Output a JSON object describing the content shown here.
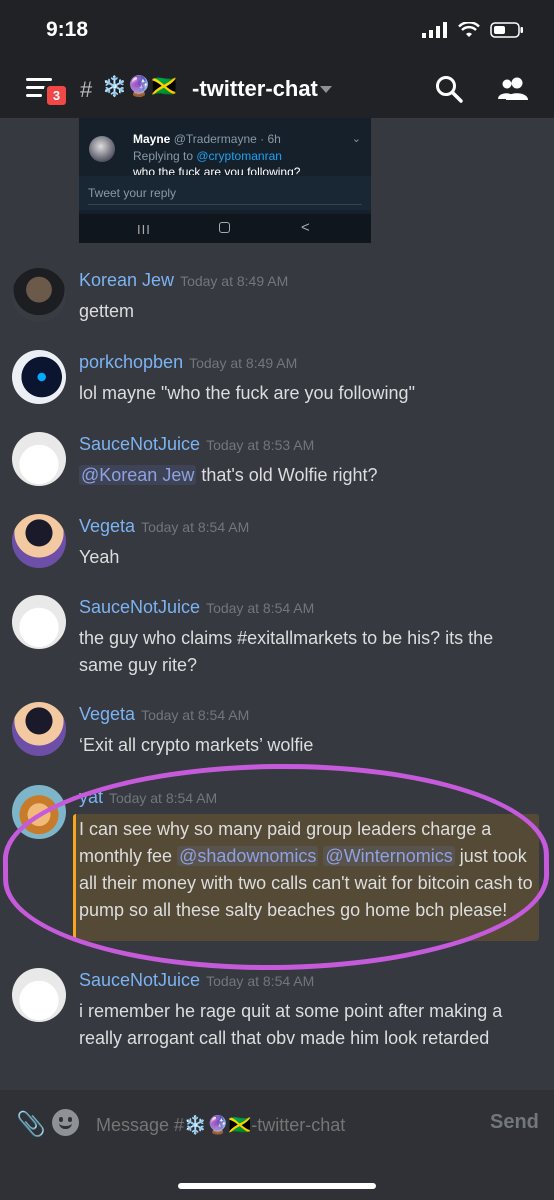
{
  "status_bar": {
    "time": "9:18"
  },
  "header": {
    "badge_count": "3",
    "channel_hash": "#",
    "channel_emoji": "❄️🔮🇯🇲",
    "channel_name": "-twitter-chat"
  },
  "embed": {
    "author": "Mayne",
    "handle": "@Tradermayne · 6h",
    "replying_prefix": "Replying to ",
    "replying_to": "@cryptomanran",
    "text": "who the fuck are you following?",
    "reply_placeholder": "Tweet your reply",
    "nav_recent": "III",
    "nav_back": "<"
  },
  "messages": [
    {
      "author": "Korean Jew",
      "timestamp": "Today at 8:49 AM",
      "text": "gettem"
    },
    {
      "author": "porkchopben",
      "timestamp": "Today at 8:49 AM",
      "text": "lol mayne \"who the fuck are you following\""
    },
    {
      "author": "SauceNotJuice",
      "timestamp": "Today at 8:53 AM",
      "mention": "@Korean Jew",
      "text": " that's old Wolfie right?"
    },
    {
      "author": "Vegeta",
      "timestamp": "Today at 8:54 AM",
      "text": "Yeah"
    },
    {
      "author": "SauceNotJuice",
      "timestamp": "Today at 8:54 AM",
      "text": "the guy who claims #exitallmarkets to be his? its the same guy rite?"
    },
    {
      "author": "Vegeta",
      "timestamp": "Today at 8:54 AM",
      "text": "‘Exit all crypto markets’ wolfie"
    },
    {
      "author": "yat",
      "timestamp": "Today at 8:54 AM",
      "text_a": "I can see why so many paid group leaders charge a monthly fee ",
      "mention_1": "@shadownomics",
      "mention_2": "@Winternomics",
      "text_b": "  just took all their money with two calls can't wait for bitcoin cash to pump so all these salty beaches go home  bch please!"
    },
    {
      "author": "SauceNotJuice",
      "timestamp": "Today at 8:54 AM",
      "text": "i remember he rage quit at some point after making a really arrogant call that obv made him look retarded"
    }
  ],
  "composer": {
    "placeholder": "Message #❄️🔮🇯🇲-twitter-chat",
    "send_label": "Send"
  },
  "colors": {
    "background": "#36393f",
    "author": "#7cb3f2",
    "highlight_bg": "#554a35",
    "highlight_bar": "#faa61a",
    "circle": "#c55bdb",
    "badge": "#f04747"
  }
}
